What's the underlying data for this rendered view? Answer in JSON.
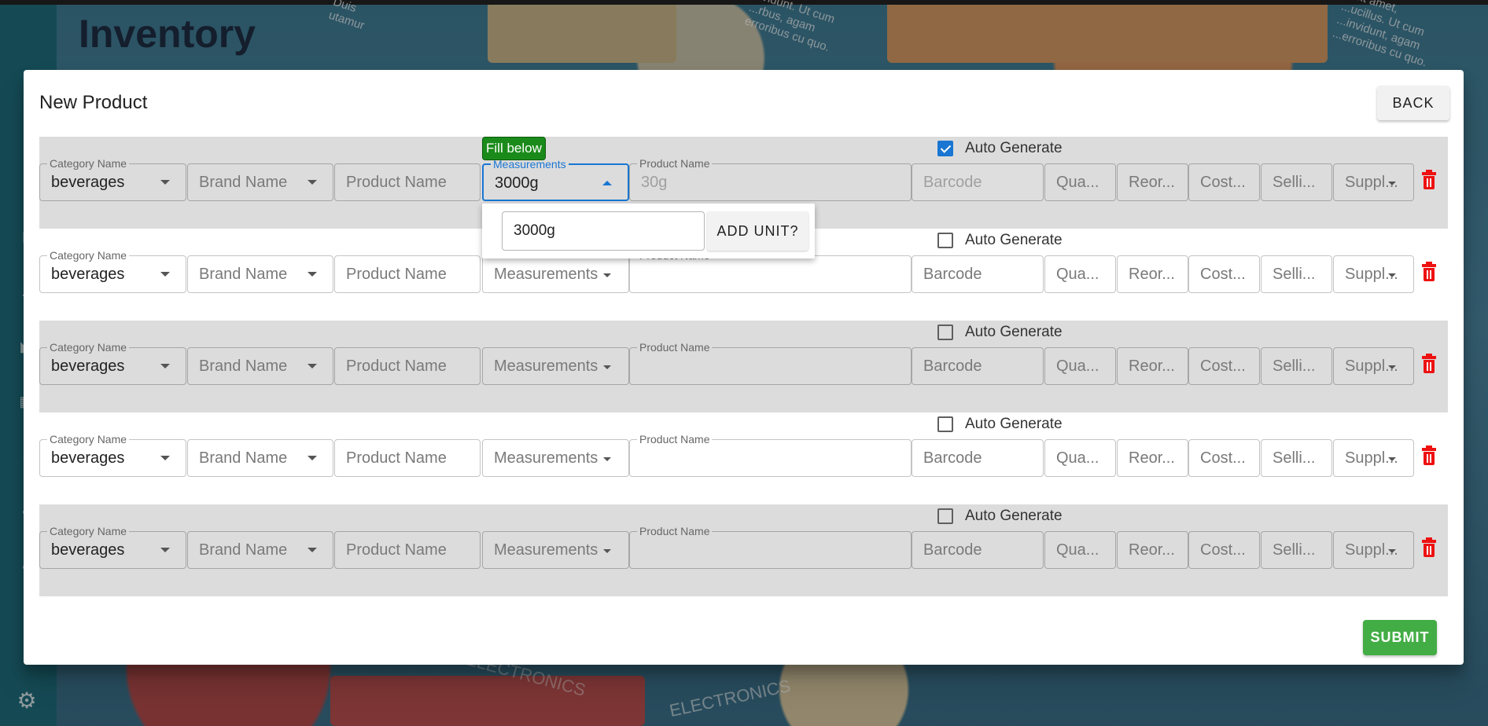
{
  "background": {
    "page_title": "Inventory",
    "scrawl_1": "Duis\nutamur",
    "scrawl_2": "invidunt. Ut cum\n...rbus, agam\nerroribus cu quo.",
    "scrawl_3": "...sit amet,\n...ucillus. Ut cum\n...invidunt, agam\n...erroribus cu quo.",
    "banner_text_1": "ELECTRONICS",
    "banner_text_2": "ELECTRONICS"
  },
  "modal": {
    "title": "New Product",
    "back_label": "BACK",
    "submit_label": "SUBMIT"
  },
  "fields": {
    "category_legend": "Category Name",
    "category_value": "beverages",
    "brand_placeholder": "Brand Name",
    "product_placeholder": "Product Name",
    "measurements_legend": "Measurements",
    "measurements_placeholder": "Measurements",
    "product_name_legend": "Product Name",
    "barcode_placeholder": "Barcode",
    "quantity_placeholder": "Qua...",
    "reorder_placeholder": "Reor...",
    "cost_placeholder": "Cost...",
    "selling_placeholder": "Selli...",
    "supplier_placeholder": "Suppl...",
    "auto_generate_label": "Auto Generate"
  },
  "rows": [
    {
      "measurements_value": "3000g",
      "product_name_value": "30g",
      "auto_generate": true
    },
    {
      "measurements_value": "",
      "product_name_value": "",
      "auto_generate": false
    },
    {
      "measurements_value": "",
      "product_name_value": "",
      "auto_generate": false
    },
    {
      "measurements_value": "",
      "product_name_value": "",
      "auto_generate": false
    },
    {
      "measurements_value": "",
      "product_name_value": "",
      "auto_generate": false
    }
  ],
  "tooltip": "Fill below",
  "unit_popup": {
    "input_value": "3000g",
    "add_label": "ADD UNIT?"
  },
  "colors": {
    "primary": "#1976d2",
    "danger": "#ee1111",
    "success": "#43ad45",
    "tooltip": "#1a8b1a"
  },
  "icons": [
    "dropdown-arrow-icon",
    "trash-icon",
    "checkbox-icon",
    "gear-icon"
  ]
}
